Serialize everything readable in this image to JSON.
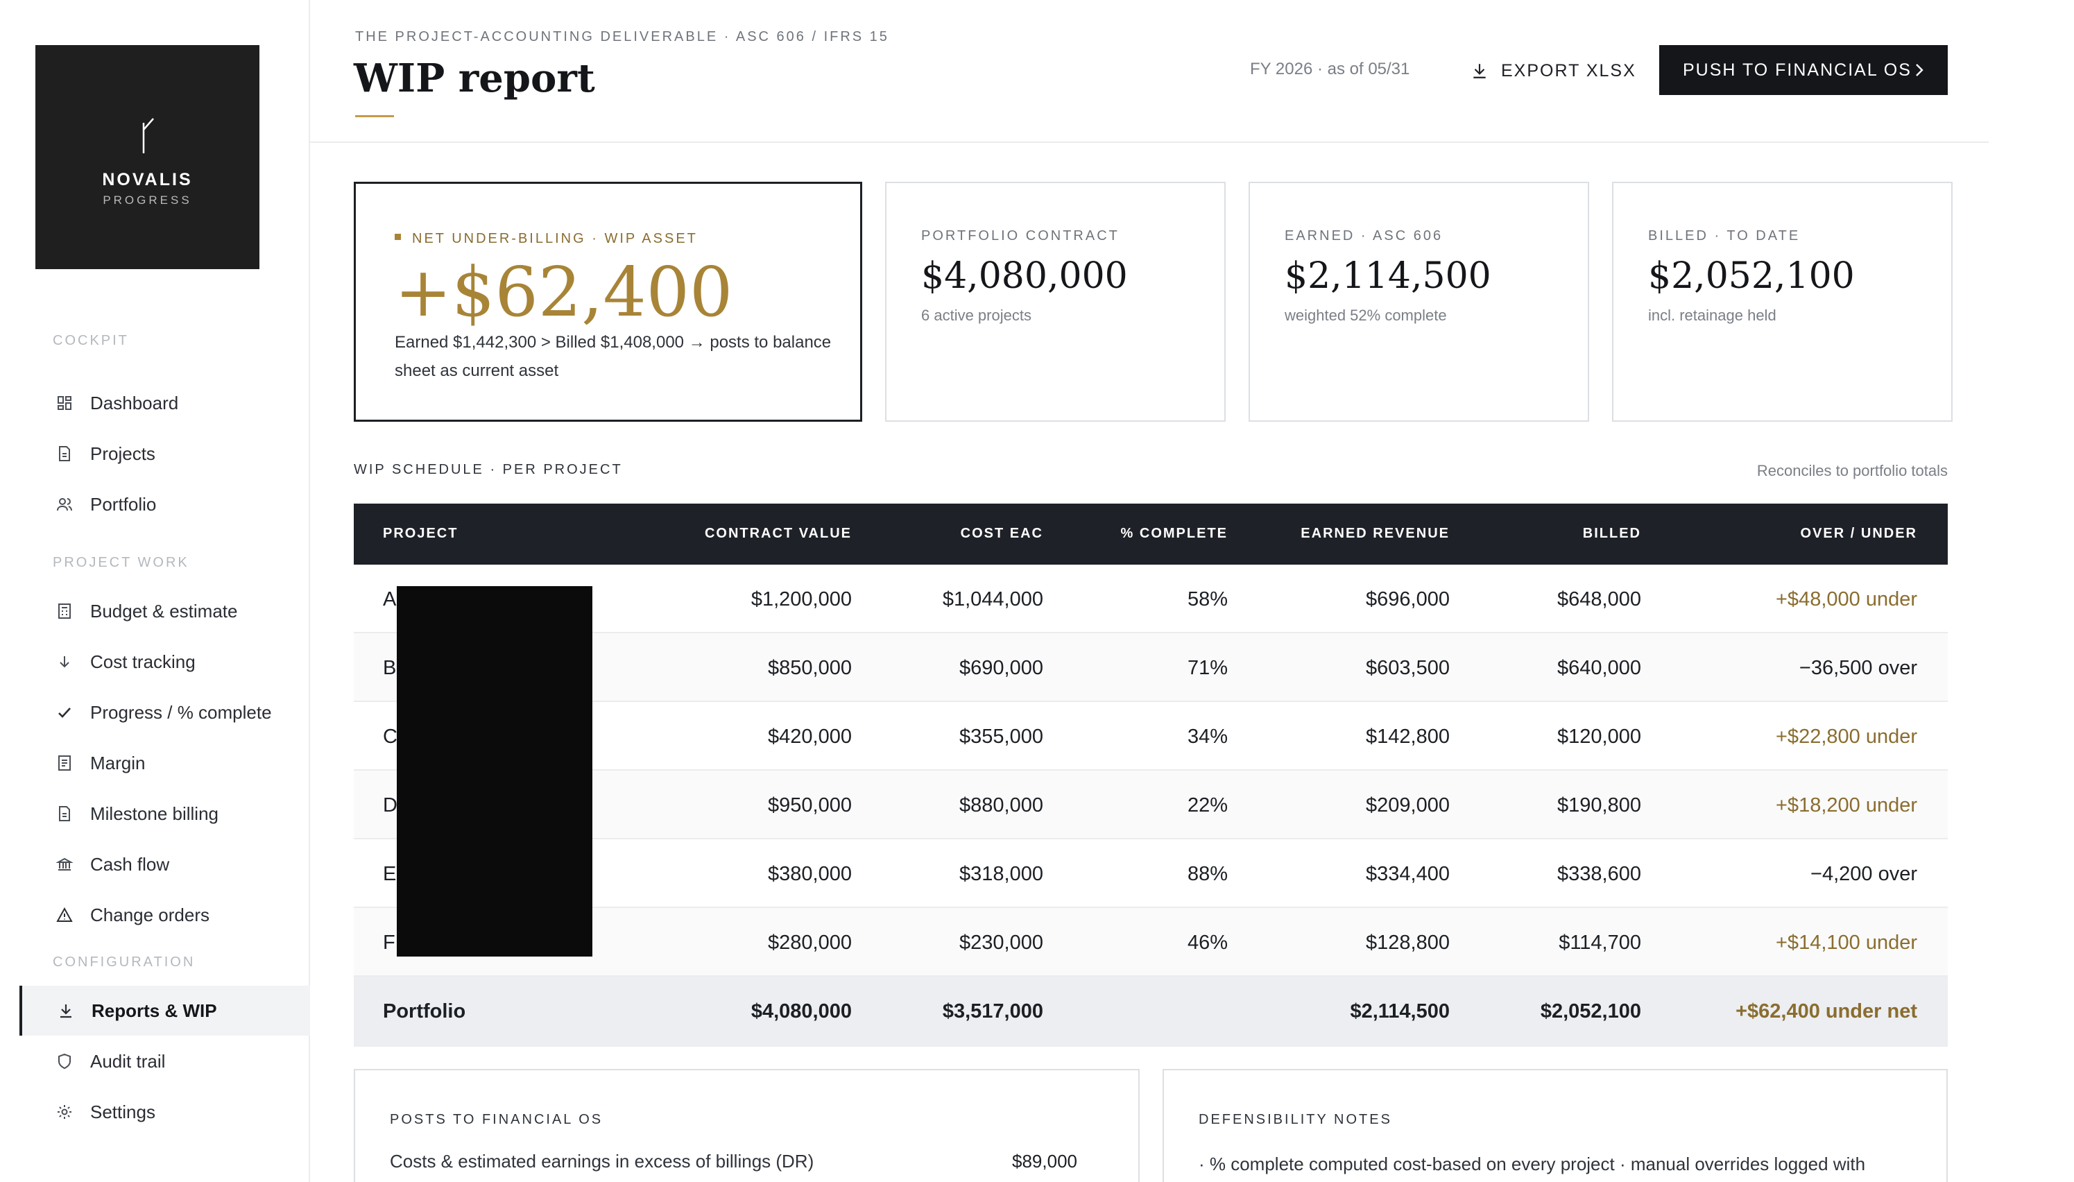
{
  "brand": {
    "name": "NOVALIS",
    "tagline": "PROGRESS"
  },
  "sidebar": {
    "sections": [
      "COCKPIT",
      "PROJECT WORK",
      "CONFIGURATION"
    ],
    "items": [
      {
        "label": "Dashboard",
        "icon": "dashboard-icon"
      },
      {
        "label": "Projects",
        "icon": "document-icon"
      },
      {
        "label": "Portfolio",
        "icon": "users-icon"
      },
      {
        "label": "Budget & estimate",
        "icon": "calculator-icon"
      },
      {
        "label": "Cost tracking",
        "icon": "arrow-down-icon"
      },
      {
        "label": "Progress / % complete",
        "icon": "check-icon"
      },
      {
        "label": "Margin",
        "icon": "ledger-icon"
      },
      {
        "label": "Milestone billing",
        "icon": "document-icon"
      },
      {
        "label": "Cash flow",
        "icon": "bank-icon"
      },
      {
        "label": "Change orders",
        "icon": "warning-icon"
      },
      {
        "label": "Reports & WIP",
        "icon": "download-icon",
        "active": true
      },
      {
        "label": "Audit trail",
        "icon": "shield-icon"
      },
      {
        "label": "Settings",
        "icon": "gear-icon"
      }
    ]
  },
  "header": {
    "eyebrow": "THE PROJECT-ACCOUNTING DELIVERABLE · ASC 606 / IFRS 15",
    "title": "WIP report",
    "period": "FY 2026 · as of 05/31",
    "export_label": "EXPORT XLSX",
    "push_label": "PUSH TO FINANCIAL OS"
  },
  "cards": {
    "hero": {
      "label": "NET UNDER-BILLING · WIP ASSET",
      "value": "+$62,400",
      "desc": "Earned $1,442,300 > Billed $1,408,000 → posts to balance sheet as current asset"
    },
    "contract": {
      "label": "PORTFOLIO CONTRACT",
      "value": "$4,080,000",
      "sub": "6 active projects"
    },
    "earned": {
      "label": "EARNED · ASC 606",
      "value": "$2,114,500",
      "sub": "weighted 52% complete"
    },
    "billed": {
      "label": "BILLED · TO DATE",
      "value": "$2,052,100",
      "sub": "incl. retainage held"
    }
  },
  "schedule": {
    "label": "WIP SCHEDULE · PER PROJECT",
    "note": "Reconciles to portfolio totals",
    "columns": [
      "PROJECT",
      "CONTRACT VALUE",
      "COST EAC",
      "% COMPLETE",
      "EARNED REVENUE",
      "BILLED",
      "OVER / UNDER"
    ],
    "rows": [
      {
        "project": "A",
        "contract": "$1,200,000",
        "cost": "$1,044,000",
        "pct": "58%",
        "earned": "$696,000",
        "billed": "$648,000",
        "ou": "+$48,000 under"
      },
      {
        "project": "B",
        "contract": "$850,000",
        "cost": "$690,000",
        "pct": "71%",
        "earned": "$603,500",
        "billed": "$640,000",
        "ou": "−36,500 over"
      },
      {
        "project": "C",
        "contract": "$420,000",
        "cost": "$355,000",
        "pct": "34%",
        "earned": "$142,800",
        "billed": "$120,000",
        "ou": "+$22,800 under"
      },
      {
        "project": "D",
        "contract": "$950,000",
        "cost": "$880,000",
        "pct": "22%",
        "earned": "$209,000",
        "billed": "$190,800",
        "ou": "+$18,200 under"
      },
      {
        "project": "E",
        "contract": "$380,000",
        "cost": "$318,000",
        "pct": "88%",
        "earned": "$334,400",
        "billed": "$338,600",
        "ou": "−4,200 over"
      },
      {
        "project": "F",
        "contract": "$280,000",
        "cost": "$230,000",
        "pct": "46%",
        "earned": "$128,800",
        "billed": "$114,700",
        "ou": "+$14,100 under"
      }
    ],
    "total": {
      "project": "Portfolio",
      "contract": "$4,080,000",
      "cost": "$3,517,000",
      "pct": "",
      "earned": "$2,114,500",
      "billed": "$2,052,100",
      "ou": "+$62,400 under net"
    }
  },
  "panels": {
    "posts": {
      "label": "POSTS TO FINANCIAL OS",
      "line": "Costs & estimated earnings in excess of billings (DR)",
      "amount": "$89,000"
    },
    "notes": {
      "label": "DEFENSIBILITY NOTES",
      "line": "· % complete computed cost-based on every project · manual overrides logged with justification"
    }
  },
  "colors": {
    "accent": "#a88437",
    "dark": "#1e2127"
  }
}
